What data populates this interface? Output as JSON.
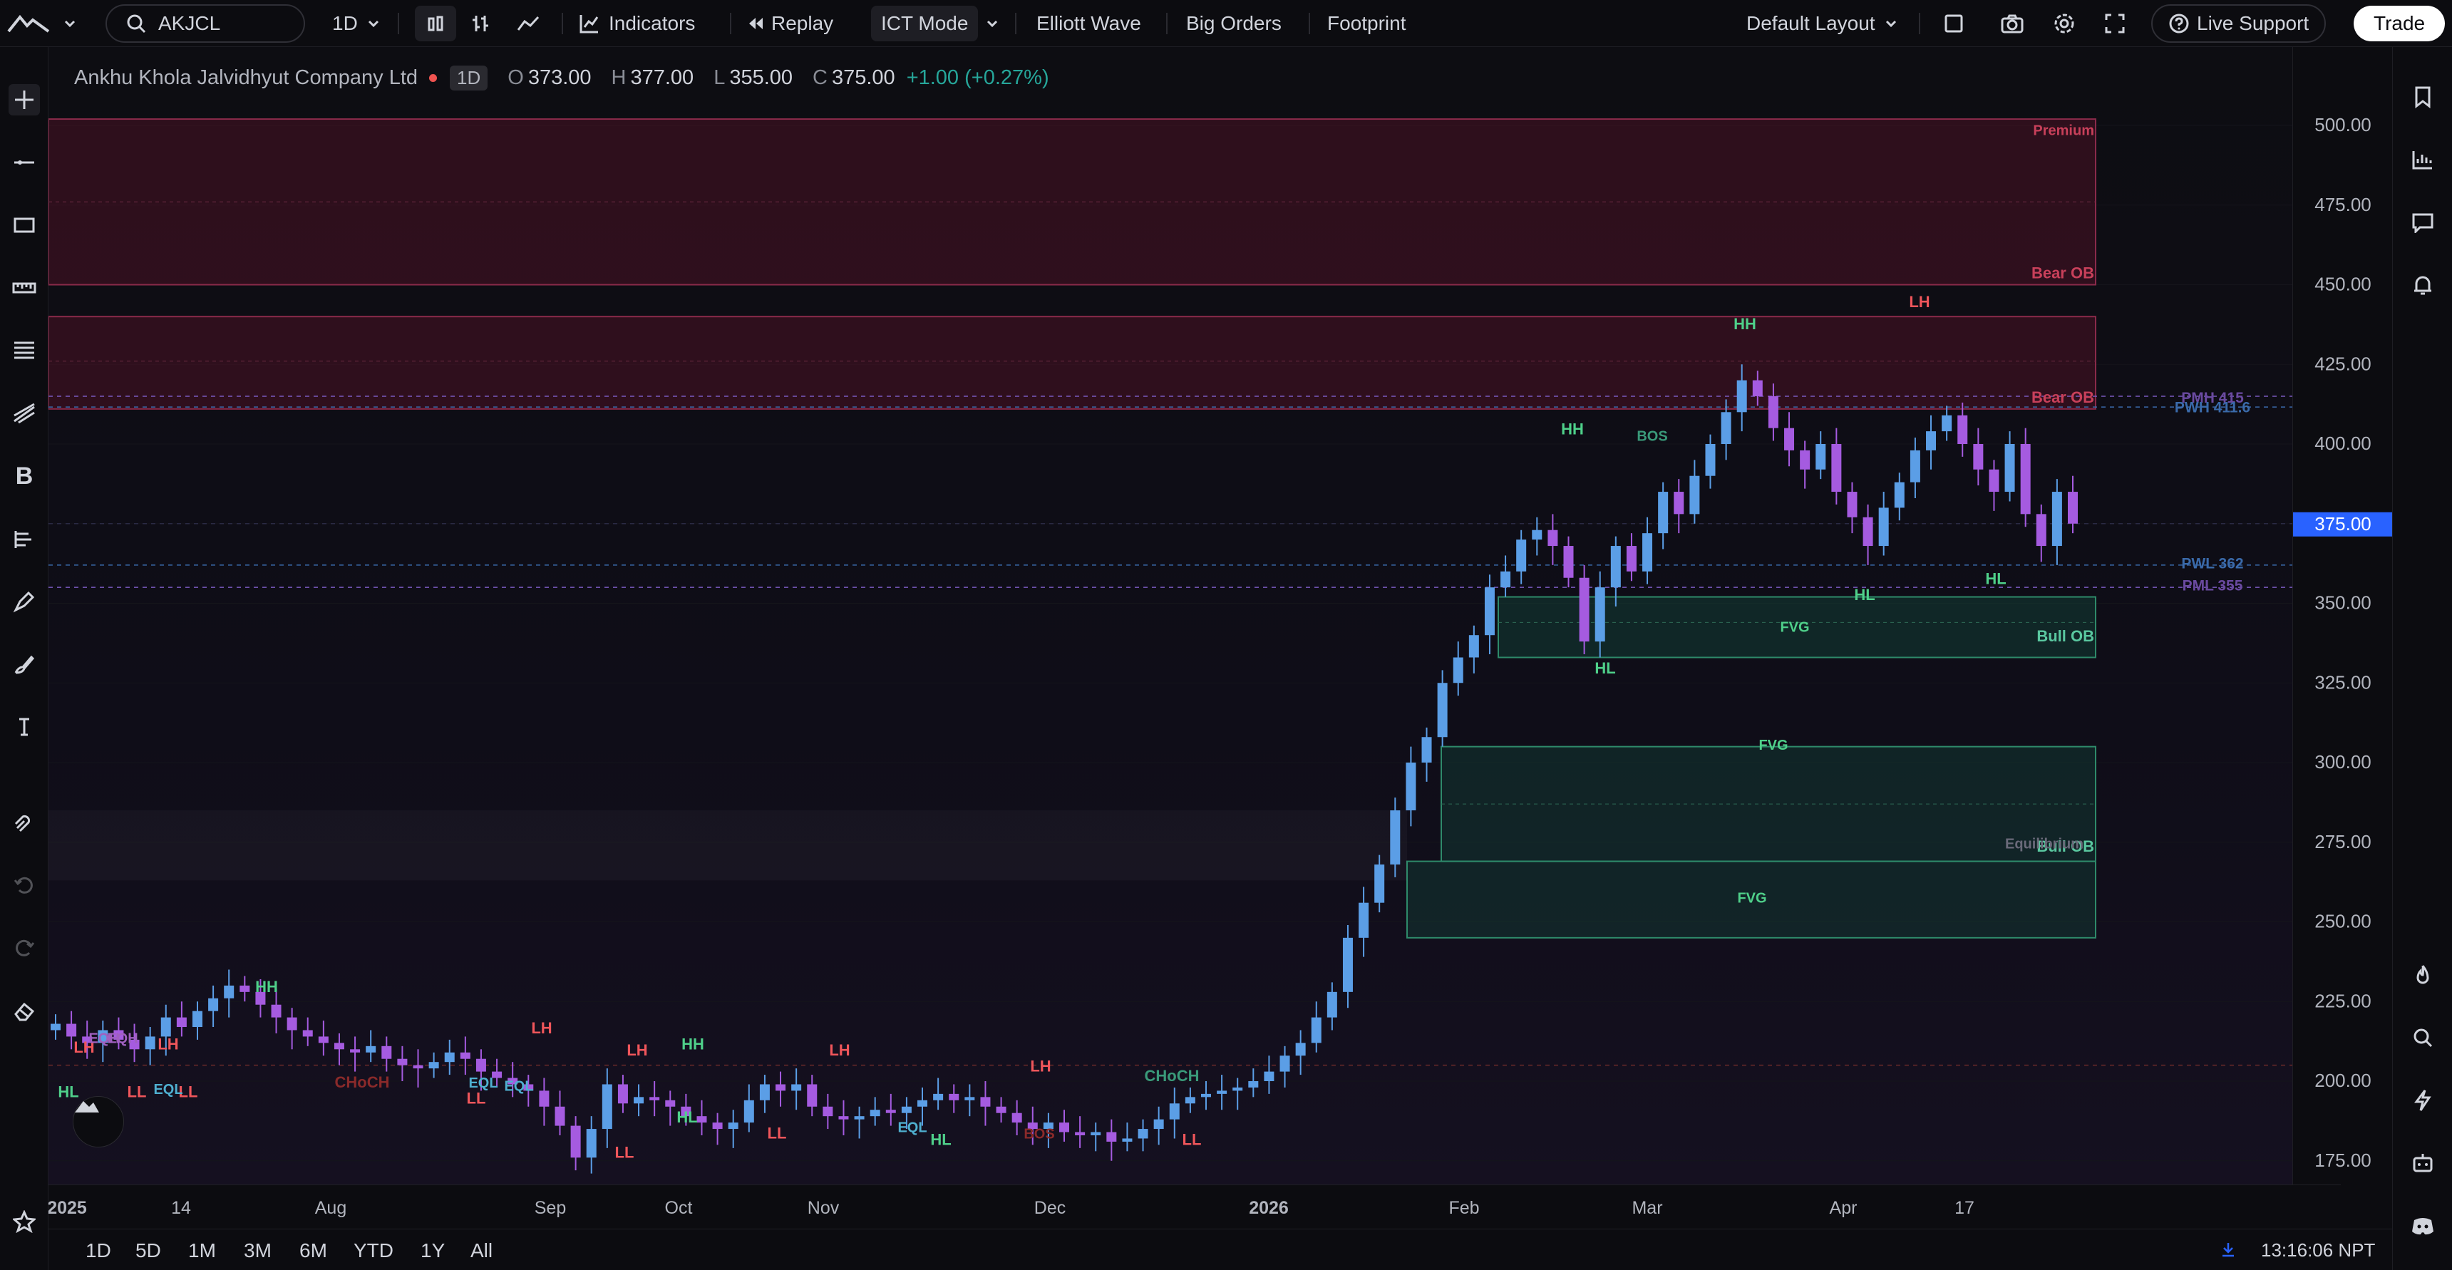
{
  "symbol": {
    "ticker": "AKJCL",
    "name": "Ankhu Khola Jalvidhyut Company Ltd",
    "timeframe": "1D"
  },
  "ohlc": {
    "o_label": "O",
    "o": "373.00",
    "h_label": "H",
    "h": "377.00",
    "l_label": "L",
    "l": "355.00",
    "c_label": "C",
    "c": "375.00",
    "change": "+1.00 (+0.27%)"
  },
  "toolbar": {
    "interval": "1D",
    "indicators_label": "Indicators",
    "replay_label": "Replay",
    "ict_mode_label": "ICT Mode",
    "elliott_label": "Elliott Wave",
    "big_orders_label": "Big Orders",
    "footprint_label": "Footprint",
    "layout_label": "Default Layout",
    "support_label": "Live Support",
    "trade_label": "Trade"
  },
  "price_axis": {
    "ticks": [
      "500.00",
      "475.00",
      "450.00",
      "425.00",
      "400.00",
      "375.00",
      "350.00",
      "325.00",
      "300.00",
      "275.00",
      "250.00",
      "225.00",
      "200.00",
      "175.00"
    ],
    "current": "375.00",
    "accent": "#2962ff"
  },
  "time_axis": {
    "labels": [
      "2025",
      "14",
      "Aug",
      "Sep",
      "Oct",
      "Nov",
      "Dec",
      "2026",
      "Feb",
      "Mar",
      "Apr",
      "17"
    ]
  },
  "bottom": {
    "ranges": [
      "1D",
      "5D",
      "1M",
      "3M",
      "6M",
      "YTD",
      "1Y",
      "All"
    ],
    "clock": "13:16:06 NPT"
  },
  "annotations": {
    "premium": "Premium",
    "bear_ob": "Bear OB",
    "bull_ob": "Bull OB",
    "fvg": "FVG",
    "equilibrium": "Equilibrium",
    "bos": "BOS",
    "choch": "CHoCH",
    "eql": "EQL",
    "eqh": "EQH",
    "pmh": "PMH 415",
    "pwh": "PWH 411.6",
    "pwl": "PWL 362",
    "pml": "PML 355",
    "hh": "HH",
    "lh": "LH",
    "hl": "HL",
    "ll": "LL"
  },
  "colors": {
    "up": "#5b9ee6",
    "down": "#a55be0",
    "bull_label": "#4fd08a",
    "bear_label": "#f0565b",
    "bear_zone": "#3a1020",
    "bull_zone": "#12302a"
  },
  "chart_data": {
    "type": "candlestick",
    "title": "",
    "x_start": "2025-07-01",
    "x_end": "2026-04-28",
    "ylim": [
      160,
      525
    ],
    "y_ticks": [
      175,
      200,
      225,
      250,
      275,
      300,
      325,
      350,
      375,
      400,
      425,
      450,
      475,
      500
    ],
    "x_labels": [
      "2025",
      "14",
      "Aug",
      "Sep",
      "Oct",
      "Nov",
      "Dec",
      "2026",
      "Feb",
      "Mar",
      "Apr",
      "17"
    ],
    "closes": [
      218,
      214,
      212,
      216,
      213,
      210,
      214,
      220,
      217,
      222,
      226,
      230,
      228,
      224,
      220,
      216,
      214,
      212,
      210,
      209,
      211,
      207,
      205,
      204,
      206,
      209,
      207,
      203,
      201,
      199,
      197,
      192,
      186,
      176,
      185,
      199,
      193,
      195,
      194,
      192,
      189,
      187,
      185,
      187,
      194,
      199,
      197,
      199,
      192,
      189,
      188,
      189,
      191,
      190,
      192,
      194,
      196,
      194,
      195,
      192,
      190,
      187,
      185,
      187,
      184,
      183,
      184,
      181,
      182,
      185,
      188,
      193,
      195,
      196,
      197,
      198,
      200,
      203,
      208,
      212,
      220,
      228,
      245,
      256,
      268,
      285,
      300,
      308,
      325,
      333,
      340,
      355,
      360,
      370,
      373,
      368,
      358,
      338,
      355,
      368,
      360,
      372,
      385,
      378,
      390,
      400,
      410,
      420,
      415,
      405,
      398,
      392,
      400,
      385,
      377,
      368,
      380,
      388,
      398,
      404,
      409,
      400,
      392,
      385,
      400,
      378,
      368,
      385,
      375
    ],
    "last_close": 375
  }
}
